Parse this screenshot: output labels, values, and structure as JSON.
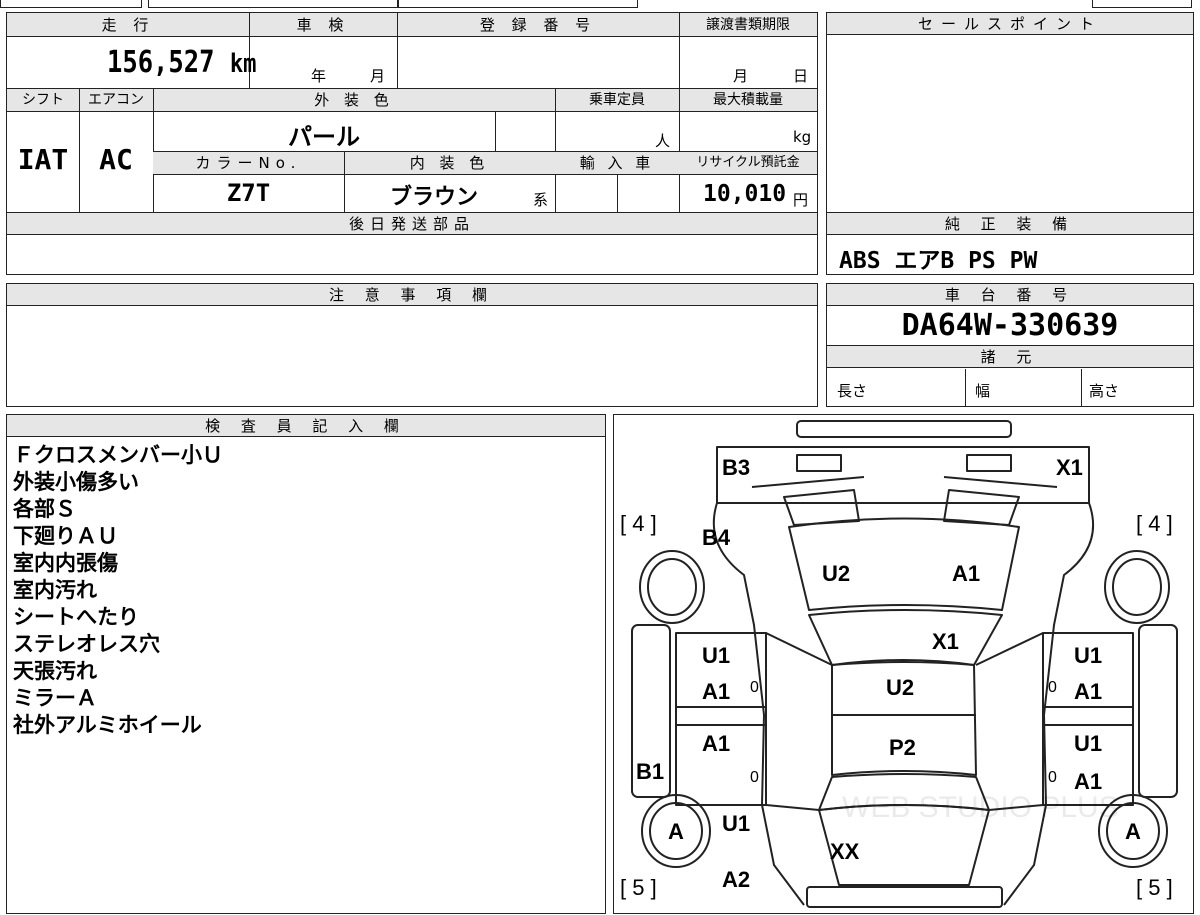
{
  "vehicle": {
    "mileage_label": "走 行",
    "mileage": "156,527",
    "mileage_unit": "km",
    "inspection_label": "車 検",
    "inspection_year_unit": "年",
    "inspection_month_unit": "月",
    "registration_label": "登 録 番 号",
    "transfer_deadline_label": "譲渡書類期限",
    "transfer_month_unit": "月",
    "transfer_day_unit": "日",
    "shift_label": "シフト",
    "shift": "IAT",
    "ac_label": "エアコン",
    "ac": "AC",
    "exterior_color_label": "外 装 色",
    "exterior_color": "パール",
    "capacity_label": "乗車定員",
    "capacity_unit": "人",
    "max_load_label": "最大積載量",
    "max_load_unit": "kg",
    "color_no_label": "カラーNo.",
    "color_no": "Z7T",
    "interior_color_label": "内 装 色",
    "interior_color": "ブラウン",
    "interior_suffix": "系",
    "import_label": "輸 入 車",
    "recycle_label": "リサイクル預託金",
    "recycle_fee": "10,010",
    "recycle_unit": "円",
    "later_parts_label": "後日発送部品"
  },
  "sales": {
    "sales_point_label": "セールスポイント",
    "equipment_label": "純 正 装 備",
    "equipment": "ABS エアB PS PW",
    "chassis_label": "車 台 番 号",
    "chassis_number": "DA64W-330639",
    "specs_label": "諸 元",
    "length_label": "長さ",
    "width_label": "幅",
    "height_label": "高さ"
  },
  "caution_label": "注 意 事 項 欄",
  "inspector": {
    "label": "検 査 員 記 入 欄",
    "notes": [
      "Ｆクロスメンバー小Ｕ",
      "外装小傷多い",
      "各部Ｓ",
      "下廻りＡＵ",
      "室内内張傷",
      "室内汚れ",
      "シートへたり",
      "ステレオレス穴",
      "天張汚れ",
      "ミラーＡ",
      "社外アルミホイール"
    ]
  },
  "diagram": {
    "front_tire_left": "[ 4 ]",
    "front_tire_right": "[ 4 ]",
    "rear_tire_left": "[ 5 ]",
    "rear_tire_right": "[ 5 ]",
    "b3": "B3",
    "x1_top": "X1",
    "b4": "B4",
    "hood_u2": "U2",
    "hood_a1": "A1",
    "windshield_x1": "X1",
    "roof_u2": "U2",
    "roof_p2": "P2",
    "left_front_door_u1": "U1",
    "left_front_door_a1": "A1",
    "left_rear_door_a1": "A1",
    "left_b1": "B1",
    "right_front_door_u1": "U1",
    "right_front_door_a1": "A1",
    "right_rear_door_u1": "U1",
    "right_rear_door_a1": "A1",
    "rear_wheel_left_a": "A",
    "rear_wheel_right_a": "A",
    "rear_u1": "U1",
    "rear_xx": "XX",
    "rear_a2": "A2",
    "zero": "0",
    "watermark": "WEB STUDIO PLUS"
  }
}
